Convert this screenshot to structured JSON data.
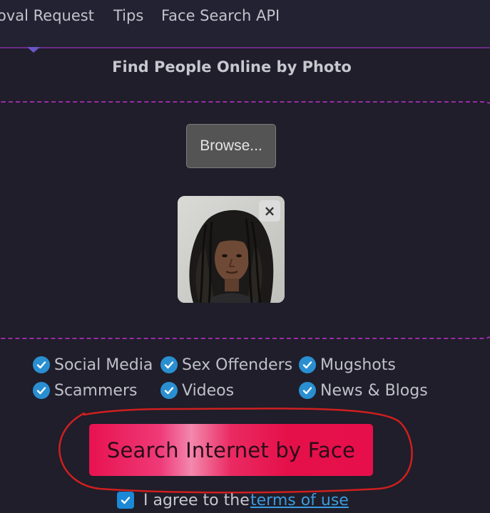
{
  "nav": {
    "items": [
      {
        "label": "oval Request"
      },
      {
        "label": "Tips"
      },
      {
        "label": "Face Search API"
      }
    ]
  },
  "page": {
    "title": "Find People Online by Photo"
  },
  "upload": {
    "browse_label": "Browse...",
    "remove_label": "×",
    "preview_icon": "portrait-photo"
  },
  "categories": [
    {
      "label": "Social Media",
      "checked": true
    },
    {
      "label": "Sex Offenders",
      "checked": true
    },
    {
      "label": "Mugshots",
      "checked": true
    },
    {
      "label": "Scammers",
      "checked": true
    },
    {
      "label": "Videos",
      "checked": true
    },
    {
      "label": "News & Blogs",
      "checked": true
    }
  ],
  "search": {
    "button_label": "Search Internet by Face"
  },
  "agreement": {
    "text": "I agree to the",
    "link_text": "terms of use",
    "checked": true
  },
  "colors": {
    "accent_pink": "#e8124f",
    "check_blue": "#2a8fd1",
    "link_blue": "#3a9be0",
    "dashed_border": "#9a2ba7",
    "annotation_red": "#d01f1f"
  }
}
